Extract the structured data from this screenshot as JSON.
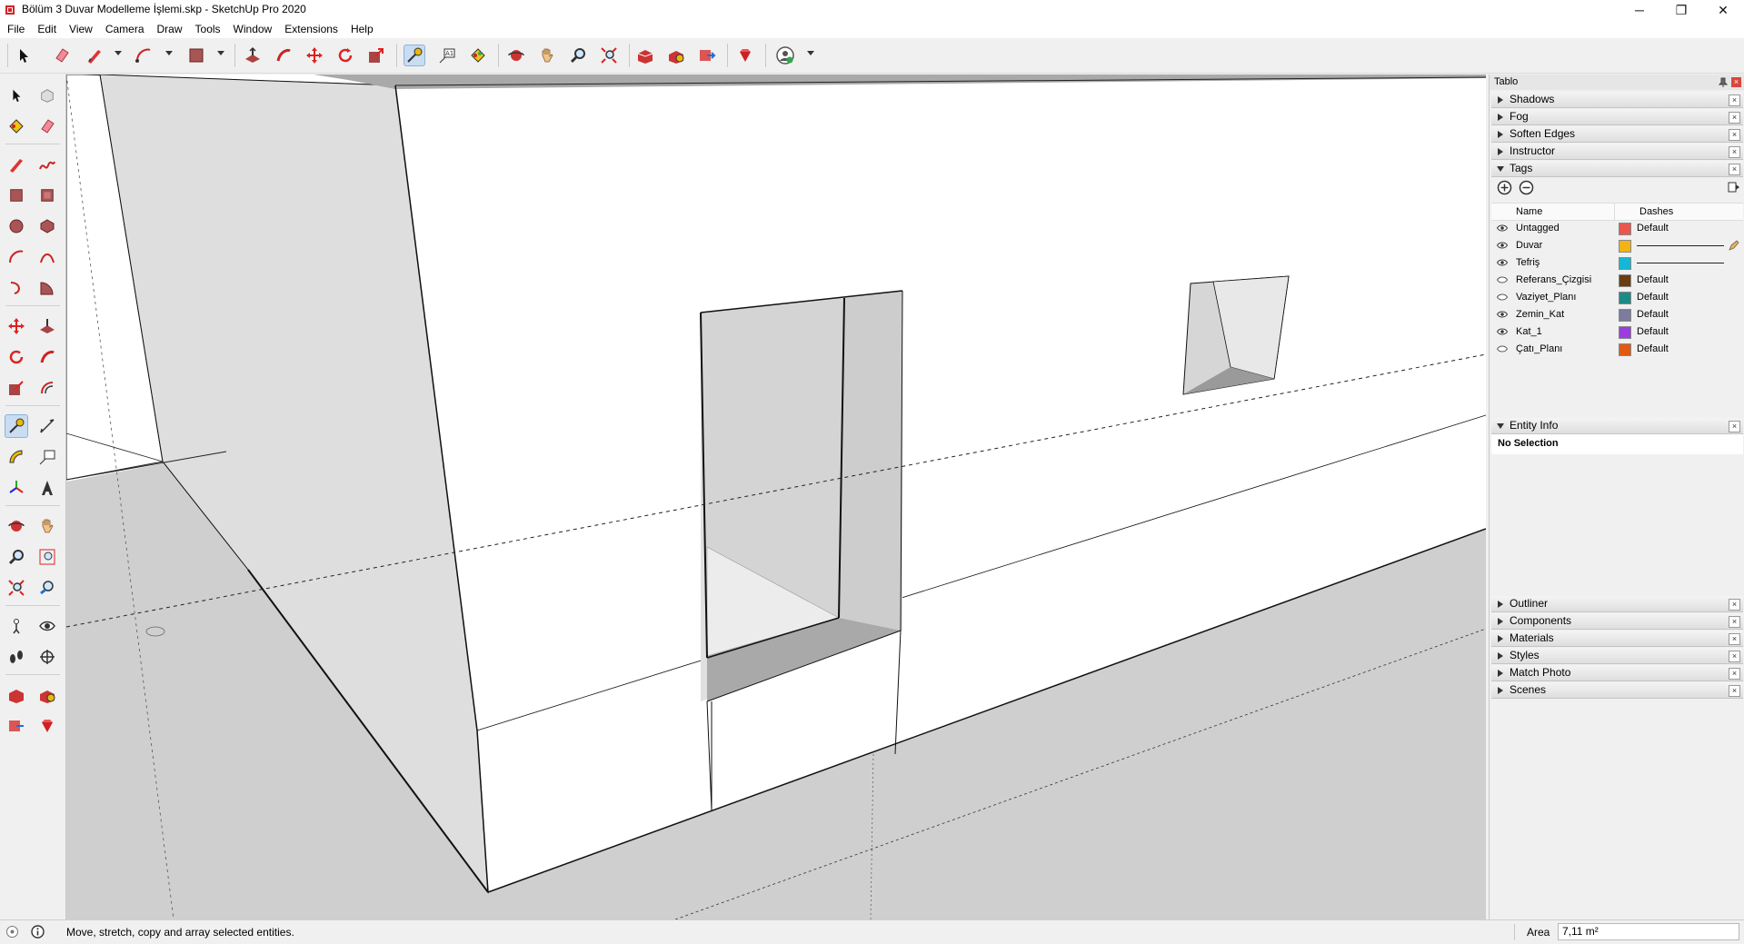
{
  "window": {
    "title": "Bölüm 3 Duvar Modelleme İşlemi.skp - SketchUp Pro 2020",
    "minimize": "─",
    "restore": "❐",
    "close": "✕"
  },
  "menubar": {
    "items": [
      "File",
      "Edit",
      "View",
      "Camera",
      "Draw",
      "Tools",
      "Window",
      "Extensions",
      "Help"
    ]
  },
  "toolbar": {
    "tools": [
      "select-icon",
      "eraser-icon",
      "line-icon",
      "arc-icon",
      "rectangle-icon",
      "push-pull-icon",
      "follow-me-icon",
      "move-icon",
      "rotate-icon",
      "scale-icon",
      "tape-measure-icon",
      "text-icon",
      "paint-bucket-icon",
      "orbit-icon",
      "pan-icon",
      "zoom-icon",
      "zoom-extents-icon",
      "3d-warehouse-icon",
      "extension-warehouse-icon",
      "layout-icon",
      "extension-manager-icon",
      "account-icon"
    ],
    "active_tool": "tape-measure-icon"
  },
  "tray": {
    "title": "Tablo",
    "collapsed_top": [
      {
        "label": "Shadows"
      },
      {
        "label": "Fog"
      },
      {
        "label": "Soften Edges"
      },
      {
        "label": "Instructor"
      }
    ],
    "tags": {
      "label": "Tags",
      "col_name": "Name",
      "col_dashes": "Dashes",
      "rows": [
        {
          "name": "Untagged",
          "color": "#e9574f",
          "dashes": "Default",
          "visible": true
        },
        {
          "name": "Duvar",
          "color": "#f2b414",
          "dashes": "",
          "visible": true
        },
        {
          "name": "Tefriş",
          "color": "#15b7d6",
          "dashes": "",
          "visible": true
        },
        {
          "name": "Referans_Çizgisi",
          "color": "#6b3d10",
          "dashes": "Default",
          "visible": false
        },
        {
          "name": "Vaziyet_Planı",
          "color": "#1b8b86",
          "dashes": "Default",
          "visible": false
        },
        {
          "name": "Zemin_Kat",
          "color": "#7c7c9c",
          "dashes": "Default",
          "visible": true
        },
        {
          "name": "Kat_1",
          "color": "#9b3de0",
          "dashes": "Default",
          "visible": true
        },
        {
          "name": "Çatı_Planı",
          "color": "#e25a12",
          "dashes": "Default",
          "visible": false
        }
      ]
    },
    "entity_info": {
      "label": "Entity Info",
      "selection": "No Selection"
    },
    "collapsed_bottom": [
      {
        "label": "Outliner"
      },
      {
        "label": "Components"
      },
      {
        "label": "Materials"
      },
      {
        "label": "Styles"
      },
      {
        "label": "Match Photo"
      },
      {
        "label": "Scenes"
      }
    ]
  },
  "statusbar": {
    "message": "Move, stretch, copy and array selected entities.",
    "measure_label": "Area",
    "measure_value": "7,11 m²"
  }
}
